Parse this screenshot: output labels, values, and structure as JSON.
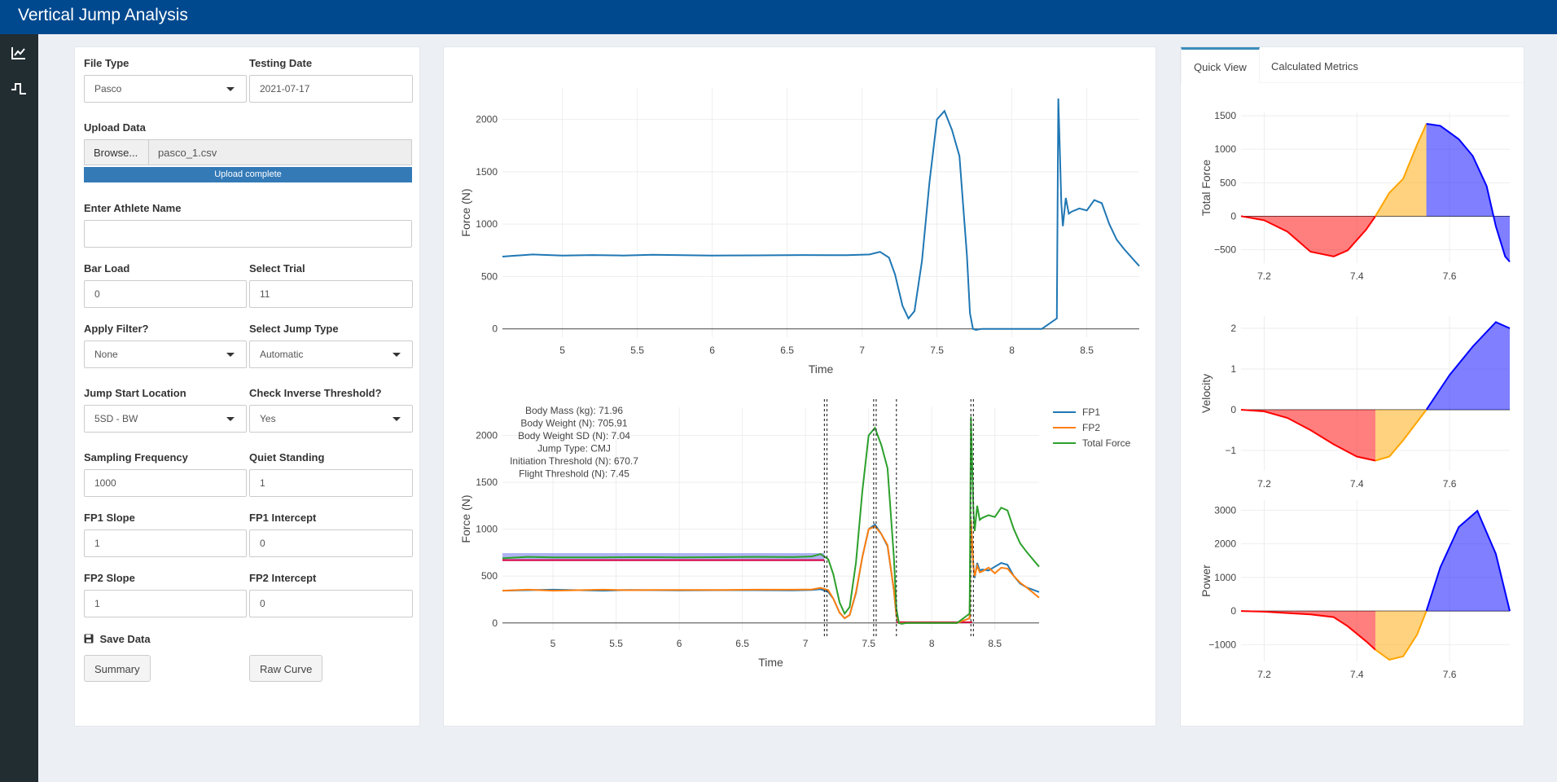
{
  "app": {
    "title": "Vertical Jump Analysis"
  },
  "sidebar": {
    "items": [
      {
        "icon": "line-chart-icon"
      },
      {
        "icon": "step-signal-icon"
      }
    ]
  },
  "form": {
    "file_type_label": "File Type",
    "file_type_value": "Pasco",
    "testing_date_label": "Testing Date",
    "testing_date_value": "2021-07-17",
    "upload_label": "Upload Data",
    "browse_label": "Browse...",
    "file_name": "pasco_1.csv",
    "upload_status": "Upload complete",
    "upload_progress": 1.0,
    "athlete_label": "Enter Athlete Name",
    "athlete_value": "",
    "bar_load_label": "Bar Load",
    "bar_load_value": "0",
    "select_trial_label": "Select Trial",
    "select_trial_value": "11",
    "apply_filter_label": "Apply Filter?",
    "apply_filter_value": "None",
    "jump_type_label": "Select Jump Type",
    "jump_type_value": "Automatic",
    "jump_start_label": "Jump Start Location",
    "jump_start_value": "5SD - BW",
    "inverse_label": "Check Inverse Threshold?",
    "inverse_value": "Yes",
    "sampling_label": "Sampling Frequency",
    "sampling_value": "1000",
    "quiet_label": "Quiet Standing",
    "quiet_value": "1",
    "fp1_slope_label": "FP1 Slope",
    "fp1_slope_value": "1",
    "fp1_intercept_label": "FP1 Intercept",
    "fp1_intercept_value": "0",
    "fp2_slope_label": "FP2 Slope",
    "fp2_slope_value": "1",
    "fp2_intercept_label": "FP2 Intercept",
    "fp2_intercept_value": "0",
    "save_label": "Save Data",
    "summary_button": "Summary",
    "raw_curve_button": "Raw Curve"
  },
  "tabs": [
    {
      "label": "Quick View",
      "active": true
    },
    {
      "label": "Calculated Metrics",
      "active": false
    }
  ],
  "colors": {
    "header": "#00498f",
    "sidebar": "#222d32",
    "fp1": "#1f77b4",
    "fp2": "#ff7f0e",
    "total": "#2ca02c",
    "neg": "#ff0000",
    "mid": "#ffa500",
    "pos": "#0000ff"
  },
  "chart_data": [
    {
      "type": "line",
      "xlabel": "Time",
      "ylabel": "Force (N)",
      "xlim": [
        4.6,
        8.85
      ],
      "ylim": [
        -80,
        2300
      ],
      "xticks": [
        5,
        5.5,
        6,
        6.5,
        7,
        7.5,
        8,
        8.5
      ],
      "xtick_labels": [
        "5",
        "5.5",
        "6",
        "6.5",
        "7",
        "7.5",
        "8",
        "8.5"
      ],
      "yticks": [
        0,
        500,
        1000,
        1500,
        2000
      ],
      "ytick_labels": [
        "0",
        "500",
        "1000",
        "1500",
        "2000"
      ],
      "series": [
        {
          "x": [
            4.6,
            4.8,
            5.0,
            5.2,
            5.4,
            5.6,
            5.8,
            6.0,
            6.3,
            6.6,
            6.9,
            7.05,
            7.12,
            7.18,
            7.22,
            7.27,
            7.31,
            7.35,
            7.4,
            7.45,
            7.5,
            7.55,
            7.6,
            7.65,
            7.7,
            7.72,
            7.74,
            7.76,
            7.8,
            8.0,
            8.2,
            8.3,
            8.31,
            8.32,
            8.33,
            8.34,
            8.36,
            8.38,
            8.4,
            8.45,
            8.5,
            8.55,
            8.6,
            8.65,
            8.7,
            8.75,
            8.85
          ],
          "y": [
            690,
            710,
            700,
            705,
            700,
            708,
            703,
            700,
            702,
            705,
            703,
            710,
            735,
            680,
            520,
            220,
            100,
            170,
            650,
            1400,
            2000,
            2080,
            1900,
            1650,
            700,
            150,
            0,
            -10,
            0,
            0,
            0,
            100,
            2200,
            1700,
            1200,
            980,
            1250,
            1100,
            1120,
            1150,
            1130,
            1230,
            1200,
            1000,
            850,
            760,
            600
          ]
        }
      ]
    },
    {
      "type": "line",
      "xlabel": "Time",
      "ylabel": "Force (N)",
      "xlim": [
        4.6,
        8.85
      ],
      "ylim": [
        -80,
        2300
      ],
      "xticks": [
        5,
        5.5,
        6,
        6.5,
        7,
        7.5,
        8,
        8.5
      ],
      "xtick_labels": [
        "5",
        "5.5",
        "6",
        "6.5",
        "7",
        "7.5",
        "8",
        "8.5"
      ],
      "yticks": [
        0,
        500,
        1000,
        1500,
        2000
      ],
      "ytick_labels": [
        "0",
        "500",
        "1000",
        "1500",
        "2000"
      ],
      "legend": "top-right",
      "annotations": [
        "Body Mass (kg): 71.96",
        "Body Weight (N): 705.91",
        "Body Weight SD (N): 7.04",
        "Jump Type: CMJ",
        "Initiation Threshold (N): 670.7",
        "Flight Threshold (N): 7.45"
      ],
      "vlines": [
        7.15,
        7.17,
        7.54,
        7.56,
        7.72,
        8.31,
        8.33
      ],
      "band": {
        "x": [
          4.6,
          7.15
        ],
        "y": [
          660,
          745
        ]
      },
      "threshold_line": {
        "x": [
          4.6,
          7.15
        ],
        "y": 670.7
      },
      "flight_line": {
        "x": [
          7.72,
          8.32
        ],
        "y": 7.45
      },
      "series": [
        {
          "name": "FP1",
          "x": [
            4.6,
            4.8,
            5.0,
            5.2,
            5.4,
            5.6,
            5.8,
            6.0,
            6.3,
            6.6,
            6.9,
            7.05,
            7.12,
            7.18,
            7.22,
            7.27,
            7.31,
            7.35,
            7.4,
            7.45,
            7.5,
            7.55,
            7.6,
            7.65,
            7.7,
            7.72,
            7.74,
            7.76,
            7.8,
            8.0,
            8.2,
            8.3,
            8.31,
            8.32,
            8.33,
            8.34,
            8.36,
            8.38,
            8.4,
            8.45,
            8.5,
            8.55,
            8.6,
            8.65,
            8.7,
            8.75,
            8.85
          ],
          "y": [
            345,
            350,
            355,
            350,
            345,
            352,
            350,
            348,
            350,
            350,
            348,
            352,
            360,
            330,
            260,
            110,
            50,
            85,
            320,
            700,
            1000,
            1050,
            950,
            820,
            350,
            70,
            0,
            -5,
            0,
            0,
            0,
            50,
            1100,
            850,
            600,
            480,
            640,
            560,
            570,
            560,
            600,
            640,
            620,
            500,
            420,
            380,
            330
          ]
        },
        {
          "name": "FP2",
          "x": [
            4.6,
            4.8,
            5.0,
            5.2,
            5.4,
            5.6,
            5.8,
            6.0,
            6.3,
            6.6,
            6.9,
            7.05,
            7.12,
            7.18,
            7.22,
            7.27,
            7.31,
            7.35,
            7.4,
            7.45,
            7.5,
            7.55,
            7.6,
            7.65,
            7.7,
            7.72,
            7.74,
            7.76,
            7.8,
            8.0,
            8.2,
            8.3,
            8.31,
            8.32,
            8.33,
            8.34,
            8.36,
            8.38,
            8.4,
            8.45,
            8.5,
            8.55,
            8.6,
            8.65,
            8.7,
            8.75,
            8.85
          ],
          "y": [
            345,
            355,
            345,
            350,
            355,
            350,
            352,
            352,
            352,
            355,
            355,
            358,
            375,
            350,
            260,
            110,
            50,
            85,
            330,
            700,
            1000,
            1030,
            950,
            830,
            350,
            80,
            0,
            -5,
            0,
            0,
            0,
            50,
            1100,
            850,
            600,
            500,
            610,
            540,
            550,
            590,
            530,
            590,
            580,
            500,
            430,
            380,
            270
          ]
        },
        {
          "name": "Total Force",
          "x": [
            4.6,
            4.8,
            5.0,
            5.2,
            5.4,
            5.6,
            5.8,
            6.0,
            6.3,
            6.6,
            6.9,
            7.05,
            7.12,
            7.18,
            7.22,
            7.27,
            7.31,
            7.35,
            7.4,
            7.45,
            7.5,
            7.55,
            7.6,
            7.65,
            7.7,
            7.72,
            7.74,
            7.76,
            7.8,
            8.0,
            8.2,
            8.3,
            8.31,
            8.32,
            8.33,
            8.34,
            8.36,
            8.38,
            8.4,
            8.45,
            8.5,
            8.55,
            8.6,
            8.65,
            8.7,
            8.75,
            8.85
          ],
          "y": [
            690,
            705,
            700,
            700,
            700,
            702,
            702,
            700,
            702,
            705,
            703,
            710,
            735,
            680,
            520,
            220,
            100,
            170,
            650,
            1400,
            2000,
            2080,
            1900,
            1650,
            700,
            150,
            0,
            -10,
            0,
            0,
            0,
            100,
            2200,
            1700,
            1200,
            980,
            1250,
            1100,
            1120,
            1150,
            1130,
            1230,
            1200,
            1000,
            850,
            760,
            600
          ]
        }
      ]
    },
    {
      "type": "area",
      "ylabel": "Total Force",
      "xlim": [
        7.15,
        7.73
      ],
      "ylim": [
        -700,
        1550
      ],
      "xticks": [
        7.2,
        7.4,
        7.6
      ],
      "xtick_labels": [
        "7.2",
        "7.4",
        "7.6"
      ],
      "yticks": [
        -500,
        0,
        500,
        1000,
        1500
      ],
      "ytick_labels": [
        "−500",
        "0",
        "500",
        "1000",
        "1500"
      ],
      "split_x": [
        7.44,
        7.55
      ],
      "x": [
        7.15,
        7.2,
        7.25,
        7.3,
        7.35,
        7.38,
        7.42,
        7.44,
        7.47,
        7.5,
        7.53,
        7.55,
        7.58,
        7.62,
        7.65,
        7.68,
        7.7,
        7.72,
        7.73
      ],
      "y": [
        0,
        -60,
        -230,
        -530,
        -600,
        -510,
        -200,
        0,
        350,
        560,
        1070,
        1380,
        1350,
        1150,
        900,
        450,
        -150,
        -600,
        -680
      ]
    },
    {
      "type": "area",
      "ylabel": "Velocity",
      "xlim": [
        7.15,
        7.73
      ],
      "ylim": [
        -1.5,
        2.3
      ],
      "xticks": [
        7.2,
        7.4,
        7.6
      ],
      "xtick_labels": [
        "7.2",
        "7.4",
        "7.6"
      ],
      "yticks": [
        -1,
        0,
        1,
        2
      ],
      "ytick_labels": [
        "−1",
        "0",
        "1",
        "2"
      ],
      "split_x": [
        7.44,
        7.55
      ],
      "x": [
        7.15,
        7.2,
        7.25,
        7.3,
        7.35,
        7.4,
        7.44,
        7.47,
        7.5,
        7.55,
        7.6,
        7.65,
        7.7,
        7.73
      ],
      "y": [
        0,
        -0.04,
        -0.2,
        -0.5,
        -0.85,
        -1.15,
        -1.25,
        -1.15,
        -0.75,
        0,
        0.85,
        1.55,
        2.15,
        2.0
      ]
    },
    {
      "type": "area",
      "ylabel": "Power",
      "xlim": [
        7.15,
        7.73
      ],
      "ylim": [
        -1500,
        3300
      ],
      "xticks": [
        7.2,
        7.4,
        7.6
      ],
      "xtick_labels": [
        "7.2",
        "7.4",
        "7.6"
      ],
      "yticks": [
        -1000,
        0,
        1000,
        2000,
        3000
      ],
      "ytick_labels": [
        "−1000",
        "0",
        "1000",
        "2000",
        "3000"
      ],
      "split_x": [
        7.44,
        7.55
      ],
      "x": [
        7.15,
        7.2,
        7.25,
        7.3,
        7.35,
        7.38,
        7.42,
        7.44,
        7.47,
        7.5,
        7.53,
        7.55,
        7.58,
        7.62,
        7.66,
        7.7,
        7.73
      ],
      "y": [
        0,
        -20,
        -60,
        -100,
        -180,
        -450,
        -900,
        -1150,
        -1450,
        -1350,
        -700,
        0,
        1300,
        2500,
        2980,
        1700,
        0
      ]
    }
  ]
}
